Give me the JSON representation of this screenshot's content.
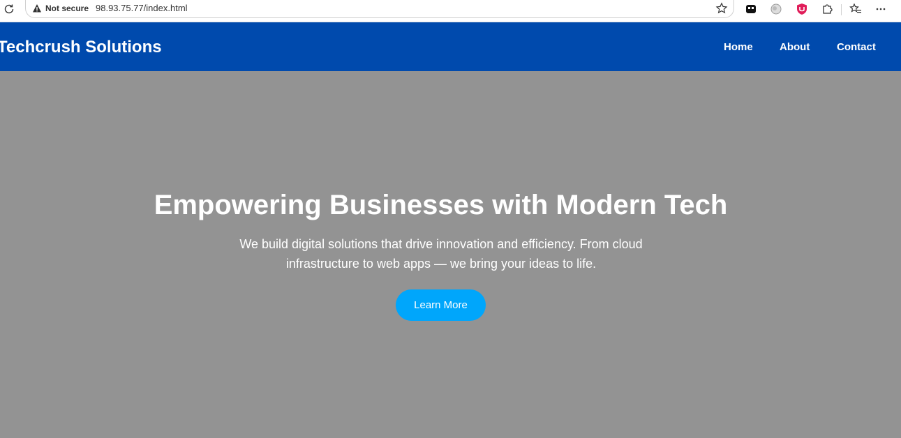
{
  "browser": {
    "security_label": "Not secure",
    "url": "98.93.75.77/index.html"
  },
  "navbar": {
    "brand": "Techcrush Solutions",
    "links": [
      {
        "label": "Home"
      },
      {
        "label": "About"
      },
      {
        "label": "Contact"
      }
    ]
  },
  "hero": {
    "title": "Empowering Businesses with Modern Tech",
    "subtitle": "We build digital solutions that drive innovation and efficiency. From cloud infrastructure to web apps — we bring your ideas to life.",
    "button_label": "Learn More"
  },
  "colors": {
    "navbar_bg": "#004aad",
    "hero_bg": "#939393",
    "cta_bg": "#00a6fb"
  },
  "icons": [
    "reload-icon",
    "warning-icon",
    "star-icon",
    "extension-tetris-icon",
    "extension-circle-icon",
    "ublock-icon",
    "puzzle-icon",
    "favorites-icon",
    "more-icon"
  ]
}
